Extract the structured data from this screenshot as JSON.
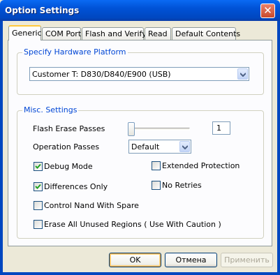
{
  "window": {
    "title": "Option Settings",
    "close_glyph": "✕"
  },
  "tabs": [
    {
      "label": "Generic"
    },
    {
      "label": "COM Port"
    },
    {
      "label": "Flash and Verify"
    },
    {
      "label": "Read"
    },
    {
      "label": "Default Contents"
    }
  ],
  "hardware": {
    "group_label": "Specify Hardware Platform",
    "selected": "Customer T: D830/D840/E900 (USB)"
  },
  "misc": {
    "group_label": "Misc. Settings",
    "flash_erase_passes_label": "Flash Erase Passes",
    "flash_erase_passes_value": "1",
    "flash_erase_passes_slider_level": 0,
    "operation_passes_label": "Operation Passes",
    "operation_passes_selected": "Default",
    "checkboxes": [
      {
        "label": "Debug Mode",
        "checked": true
      },
      {
        "label": "Extended Protection",
        "checked": false
      },
      {
        "label": "Differences Only",
        "checked": true
      },
      {
        "label": "No Retries",
        "checked": false
      },
      {
        "label": "Control Nand With Spare",
        "checked": false
      },
      {
        "label": "Erase All Unused Regions ( Use With Caution )",
        "checked": false
      }
    ]
  },
  "buttons": {
    "ok": "OK",
    "cancel": "Отмена",
    "apply": "Применить"
  },
  "colors": {
    "titlebar": "#0052d6",
    "group_label": "#0046d5",
    "active_tab_accent": "#ffc83c"
  }
}
